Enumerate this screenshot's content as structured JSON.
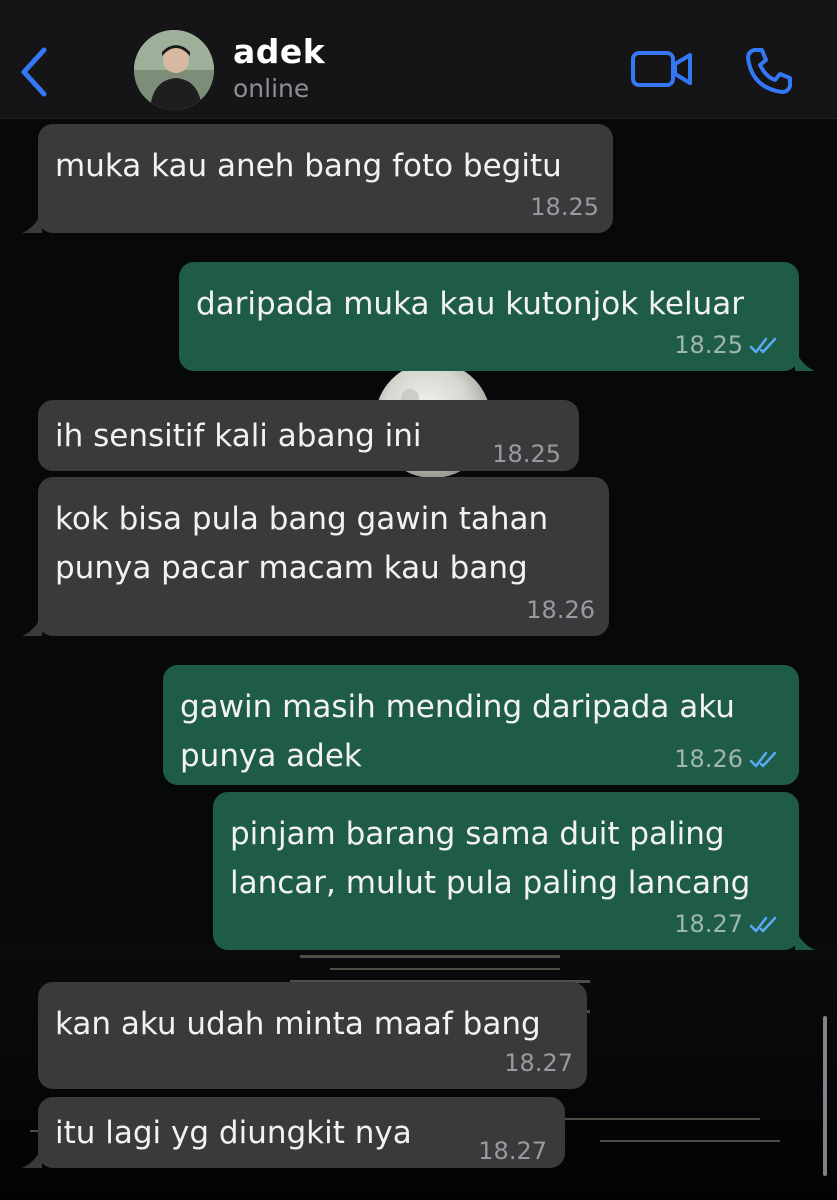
{
  "header": {
    "back_icon": "chevron-left-icon",
    "contact_name": "adek",
    "status": "online",
    "video_icon": "video-camera-icon",
    "call_icon": "phone-icon",
    "accent_color": "#3478f6"
  },
  "messages": [
    {
      "direction": "incoming",
      "text": "muka kau aneh bang foto begitu",
      "time": "18.25"
    },
    {
      "direction": "outgoing",
      "text": "daripada muka kau kutonjok keluar",
      "time": "18.25",
      "read": true
    },
    {
      "direction": "incoming",
      "text": "ih sensitif kali abang ini",
      "time": "18.25"
    },
    {
      "direction": "incoming",
      "text": "kok bisa pula bang gawin tahan\npunya pacar macam kau bang",
      "time": "18.26"
    },
    {
      "direction": "outgoing",
      "text": "gawin masih mending daripada aku\npunya adek",
      "time": "18.26",
      "read": true
    },
    {
      "direction": "outgoing",
      "text": "pinjam barang sama duit paling\nlancar, mulut pula paling lancang",
      "time": "18.27",
      "read": true
    },
    {
      "direction": "incoming",
      "text": "kan aku udah minta maaf bang",
      "time": "18.27"
    },
    {
      "direction": "incoming",
      "text": "itu lagi yg diungkit nya",
      "time": "18.27"
    }
  ],
  "colors": {
    "incoming_bubble": "#3a3a3c",
    "outgoing_bubble": "#1f5c48",
    "read_tick": "#5aa9f5"
  }
}
